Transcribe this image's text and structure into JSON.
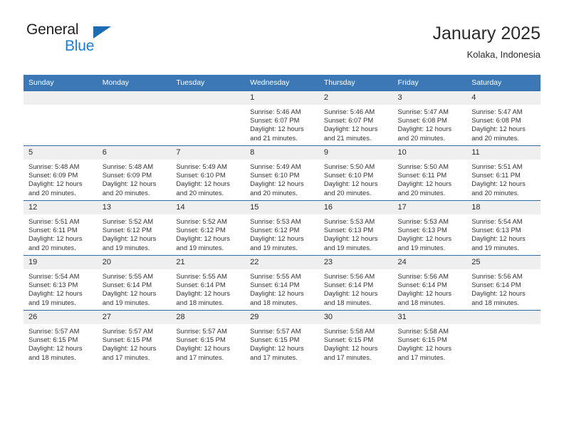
{
  "brand": {
    "name_top": "General",
    "name_bottom": "Blue",
    "triangle_color": "#1b6cb5",
    "blue_color": "#1b7ed6"
  },
  "header": {
    "title": "January 2025",
    "subtitle": "Kolaka, Indonesia"
  },
  "theme": {
    "header_bg": "#3b78b5",
    "row_divider": "#2f6ca8",
    "daynum_bg": "#efefef"
  },
  "weekdays": [
    "Sunday",
    "Monday",
    "Tuesday",
    "Wednesday",
    "Thursday",
    "Friday",
    "Saturday"
  ],
  "weeks": [
    [
      {
        "day": "",
        "blank": true
      },
      {
        "day": "",
        "blank": true
      },
      {
        "day": "",
        "blank": true
      },
      {
        "day": "1",
        "sunrise": "Sunrise: 5:46 AM",
        "sunset": "Sunset: 6:07 PM",
        "daylight": "Daylight: 12 hours and 21 minutes."
      },
      {
        "day": "2",
        "sunrise": "Sunrise: 5:46 AM",
        "sunset": "Sunset: 6:07 PM",
        "daylight": "Daylight: 12 hours and 21 minutes."
      },
      {
        "day": "3",
        "sunrise": "Sunrise: 5:47 AM",
        "sunset": "Sunset: 6:08 PM",
        "daylight": "Daylight: 12 hours and 20 minutes."
      },
      {
        "day": "4",
        "sunrise": "Sunrise: 5:47 AM",
        "sunset": "Sunset: 6:08 PM",
        "daylight": "Daylight: 12 hours and 20 minutes."
      }
    ],
    [
      {
        "day": "5",
        "sunrise": "Sunrise: 5:48 AM",
        "sunset": "Sunset: 6:09 PM",
        "daylight": "Daylight: 12 hours and 20 minutes."
      },
      {
        "day": "6",
        "sunrise": "Sunrise: 5:48 AM",
        "sunset": "Sunset: 6:09 PM",
        "daylight": "Daylight: 12 hours and 20 minutes."
      },
      {
        "day": "7",
        "sunrise": "Sunrise: 5:49 AM",
        "sunset": "Sunset: 6:10 PM",
        "daylight": "Daylight: 12 hours and 20 minutes."
      },
      {
        "day": "8",
        "sunrise": "Sunrise: 5:49 AM",
        "sunset": "Sunset: 6:10 PM",
        "daylight": "Daylight: 12 hours and 20 minutes."
      },
      {
        "day": "9",
        "sunrise": "Sunrise: 5:50 AM",
        "sunset": "Sunset: 6:10 PM",
        "daylight": "Daylight: 12 hours and 20 minutes."
      },
      {
        "day": "10",
        "sunrise": "Sunrise: 5:50 AM",
        "sunset": "Sunset: 6:11 PM",
        "daylight": "Daylight: 12 hours and 20 minutes."
      },
      {
        "day": "11",
        "sunrise": "Sunrise: 5:51 AM",
        "sunset": "Sunset: 6:11 PM",
        "daylight": "Daylight: 12 hours and 20 minutes."
      }
    ],
    [
      {
        "day": "12",
        "sunrise": "Sunrise: 5:51 AM",
        "sunset": "Sunset: 6:11 PM",
        "daylight": "Daylight: 12 hours and 20 minutes."
      },
      {
        "day": "13",
        "sunrise": "Sunrise: 5:52 AM",
        "sunset": "Sunset: 6:12 PM",
        "daylight": "Daylight: 12 hours and 19 minutes."
      },
      {
        "day": "14",
        "sunrise": "Sunrise: 5:52 AM",
        "sunset": "Sunset: 6:12 PM",
        "daylight": "Daylight: 12 hours and 19 minutes."
      },
      {
        "day": "15",
        "sunrise": "Sunrise: 5:53 AM",
        "sunset": "Sunset: 6:12 PM",
        "daylight": "Daylight: 12 hours and 19 minutes."
      },
      {
        "day": "16",
        "sunrise": "Sunrise: 5:53 AM",
        "sunset": "Sunset: 6:13 PM",
        "daylight": "Daylight: 12 hours and 19 minutes."
      },
      {
        "day": "17",
        "sunrise": "Sunrise: 5:53 AM",
        "sunset": "Sunset: 6:13 PM",
        "daylight": "Daylight: 12 hours and 19 minutes."
      },
      {
        "day": "18",
        "sunrise": "Sunrise: 5:54 AM",
        "sunset": "Sunset: 6:13 PM",
        "daylight": "Daylight: 12 hours and 19 minutes."
      }
    ],
    [
      {
        "day": "19",
        "sunrise": "Sunrise: 5:54 AM",
        "sunset": "Sunset: 6:13 PM",
        "daylight": "Daylight: 12 hours and 19 minutes."
      },
      {
        "day": "20",
        "sunrise": "Sunrise: 5:55 AM",
        "sunset": "Sunset: 6:14 PM",
        "daylight": "Daylight: 12 hours and 19 minutes."
      },
      {
        "day": "21",
        "sunrise": "Sunrise: 5:55 AM",
        "sunset": "Sunset: 6:14 PM",
        "daylight": "Daylight: 12 hours and 18 minutes."
      },
      {
        "day": "22",
        "sunrise": "Sunrise: 5:55 AM",
        "sunset": "Sunset: 6:14 PM",
        "daylight": "Daylight: 12 hours and 18 minutes."
      },
      {
        "day": "23",
        "sunrise": "Sunrise: 5:56 AM",
        "sunset": "Sunset: 6:14 PM",
        "daylight": "Daylight: 12 hours and 18 minutes."
      },
      {
        "day": "24",
        "sunrise": "Sunrise: 5:56 AM",
        "sunset": "Sunset: 6:14 PM",
        "daylight": "Daylight: 12 hours and 18 minutes."
      },
      {
        "day": "25",
        "sunrise": "Sunrise: 5:56 AM",
        "sunset": "Sunset: 6:14 PM",
        "daylight": "Daylight: 12 hours and 18 minutes."
      }
    ],
    [
      {
        "day": "26",
        "sunrise": "Sunrise: 5:57 AM",
        "sunset": "Sunset: 6:15 PM",
        "daylight": "Daylight: 12 hours and 18 minutes."
      },
      {
        "day": "27",
        "sunrise": "Sunrise: 5:57 AM",
        "sunset": "Sunset: 6:15 PM",
        "daylight": "Daylight: 12 hours and 17 minutes."
      },
      {
        "day": "28",
        "sunrise": "Sunrise: 5:57 AM",
        "sunset": "Sunset: 6:15 PM",
        "daylight": "Daylight: 12 hours and 17 minutes."
      },
      {
        "day": "29",
        "sunrise": "Sunrise: 5:57 AM",
        "sunset": "Sunset: 6:15 PM",
        "daylight": "Daylight: 12 hours and 17 minutes."
      },
      {
        "day": "30",
        "sunrise": "Sunrise: 5:58 AM",
        "sunset": "Sunset: 6:15 PM",
        "daylight": "Daylight: 12 hours and 17 minutes."
      },
      {
        "day": "31",
        "sunrise": "Sunrise: 5:58 AM",
        "sunset": "Sunset: 6:15 PM",
        "daylight": "Daylight: 12 hours and 17 minutes."
      },
      {
        "day": "",
        "blank": true
      }
    ]
  ]
}
